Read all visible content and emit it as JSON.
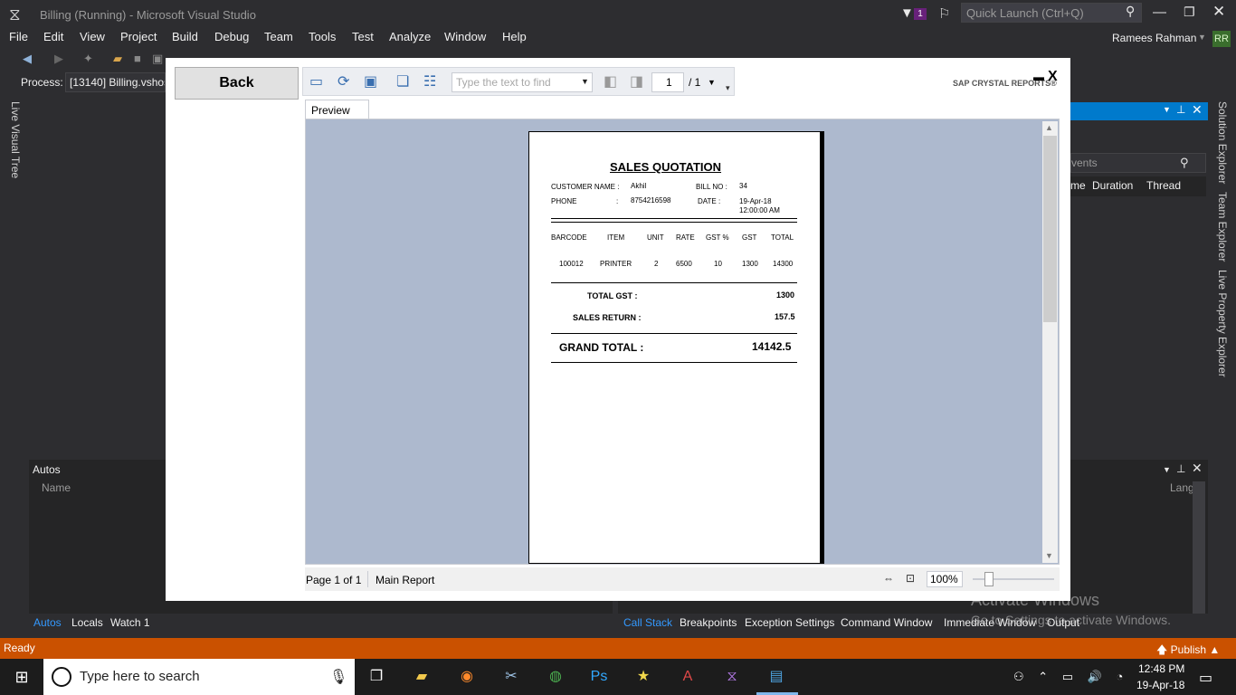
{
  "titlebar": {
    "title": "Billing (Running) - Microsoft Visual Studio",
    "notification_count": "1",
    "quick_launch_placeholder": "Quick Launch (Ctrl+Q)"
  },
  "menu": [
    "File",
    "Edit",
    "View",
    "Project",
    "Build",
    "Debug",
    "Team",
    "Tools",
    "Test",
    "Analyze",
    "Window",
    "Help"
  ],
  "account": {
    "name": "Ramees Rahman",
    "initials": "RR"
  },
  "process": {
    "label": "Process:",
    "value": "[13140] Billing.vshos"
  },
  "left_tabs": {
    "live_visual_tree": "Live Visual Tree"
  },
  "right_tabs": {
    "solution_explorer": "Solution Explorer",
    "team_explorer": "Team Explorer",
    "live_property_explorer": "Live Property Explorer"
  },
  "diagnostics": {
    "search_text": "vents",
    "columns": [
      "me",
      "Duration",
      "Thread"
    ]
  },
  "autos_panel": {
    "title": "Autos",
    "name_column": "Name",
    "tabs": [
      "Autos",
      "Locals",
      "Watch 1"
    ]
  },
  "bottom_right_tabs": [
    "Call Stack",
    "Breakpoints",
    "Exception Settings",
    "Command Window",
    "Immediate Window",
    "Output"
  ],
  "callstack": {
    "lang_column": "Lang"
  },
  "watermark": {
    "title": "Activate Windows",
    "subtitle": "Go to Settings to activate Windows."
  },
  "status_bar": {
    "text": "Ready",
    "publish": "Publish"
  },
  "taskbar": {
    "search_placeholder": "Type here to search",
    "time": "12:48 PM",
    "date": "19-Apr-18"
  },
  "report_viewer": {
    "back_label": "Back",
    "search_placeholder": "Type the text to find",
    "page_input": "1",
    "page_total": "/ 1",
    "brand": "SAP CRYSTAL REPORTS®",
    "close_label": "X",
    "preview_tab": "Preview",
    "page_info": "Page 1 of 1",
    "report_name": "Main Report",
    "zoom": "100%",
    "zoom_level_percent": 25
  },
  "report": {
    "title": "SALES QUOTATION",
    "customer_label": "CUSTOMER NAME :",
    "customer_value": "Akhil",
    "phone_label": "PHONE",
    "phone_colon": ":",
    "phone_value": "8754216598",
    "bill_label": "BILL NO :",
    "bill_value": "34",
    "date_label": "DATE :",
    "date_value": "19-Apr-18",
    "time_value": "12:00:00 AM",
    "columns": [
      "BARCODE",
      "ITEM",
      "UNIT",
      "RATE",
      "GST %",
      "GST",
      "TOTAL"
    ],
    "row": [
      "100012",
      "PRINTER",
      "2",
      "6500",
      "10",
      "1300",
      "14300"
    ],
    "total_gst_label": "TOTAL GST :",
    "total_gst_value": "1300",
    "sales_return_label": "SALES RETURN :",
    "sales_return_value": "157.5",
    "grand_total_label": "GRAND TOTAL :",
    "grand_total_value": "14142.5"
  }
}
